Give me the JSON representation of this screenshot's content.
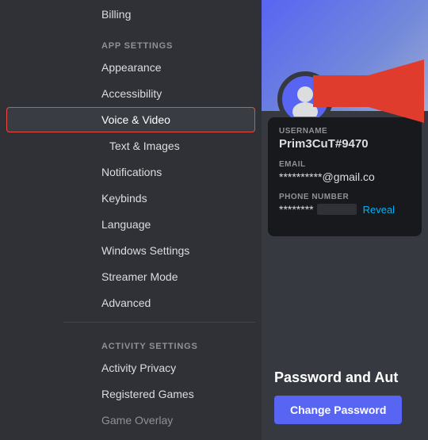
{
  "sidebar": {
    "billing_label": "Billing",
    "app_settings_header": "APP SETTINGS",
    "activity_settings_header": "ACTIVITY SETTINGS",
    "nav_items": [
      {
        "id": "appearance",
        "label": "Appearance",
        "active": false
      },
      {
        "id": "accessibility",
        "label": "Accessibility",
        "active": false
      },
      {
        "id": "voice-video",
        "label": "Voice & Video",
        "active": true
      },
      {
        "id": "text-images",
        "label": "Text & Images",
        "active": false
      },
      {
        "id": "notifications",
        "label": "Notifications",
        "active": false
      },
      {
        "id": "keybinds",
        "label": "Keybinds",
        "active": false
      },
      {
        "id": "language",
        "label": "Language",
        "active": false
      },
      {
        "id": "windows-settings",
        "label": "Windows Settings",
        "active": false
      },
      {
        "id": "streamer-mode",
        "label": "Streamer Mode",
        "active": false
      },
      {
        "id": "advanced",
        "label": "Advanced",
        "active": false
      }
    ],
    "activity_items": [
      {
        "id": "activity-privacy",
        "label": "Activity Privacy",
        "active": false
      },
      {
        "id": "registered-games",
        "label": "Registered Games",
        "active": false
      },
      {
        "id": "game-overlay",
        "label": "Game Overlay",
        "active": false
      }
    ]
  },
  "profile": {
    "username_label": "USERNAME",
    "username_value": "Prim3CuT#9470",
    "email_label": "EMAIL",
    "email_value": "**********@gmail.co",
    "phone_label": "PHONE NUMBER",
    "phone_value": "********",
    "phone_hidden": "       ",
    "reveal_label": "Reveal"
  },
  "password_section": {
    "title": "Password and Aut",
    "change_btn": "Change Password"
  }
}
